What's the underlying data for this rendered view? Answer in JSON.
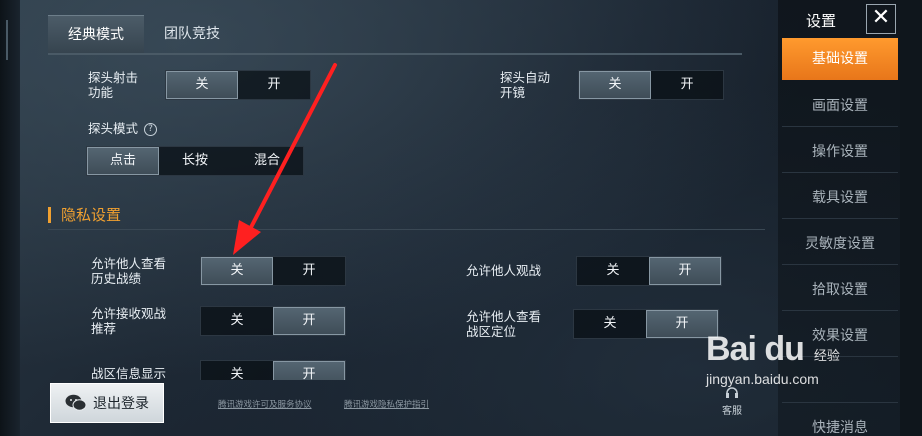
{
  "tabs": [
    {
      "label": "经典模式",
      "active": true
    },
    {
      "label": "团队竞技",
      "active": false
    }
  ],
  "settings": {
    "peek_shoot": {
      "label": "探头射击\n功能",
      "options": [
        "关",
        "开"
      ],
      "selected": "关"
    },
    "peek_auto_scope": {
      "label": "探头自动\n开镜",
      "options": [
        "关",
        "开"
      ],
      "selected": "关"
    },
    "peek_mode": {
      "label": "探头模式",
      "options": [
        "点击",
        "长按",
        "混合"
      ],
      "selected": "点击"
    }
  },
  "privacy": {
    "title": "隐私设置",
    "history": {
      "label": "允许他人查看\n历史战绩",
      "options": [
        "关",
        "开"
      ],
      "selected": "关"
    },
    "spectate": {
      "label": "允许他人观战",
      "options": [
        "关",
        "开"
      ],
      "selected": "开"
    },
    "spectate_push": {
      "label": "允许接收观战\n推荐",
      "options": [
        "关",
        "开"
      ],
      "selected": "开"
    },
    "region": {
      "label": "允许他人查看\n战区定位",
      "options": [
        "关",
        "开"
      ],
      "selected": "开"
    },
    "region_info": {
      "label": "战区信息显示",
      "options": [
        "关",
        "开"
      ],
      "selected": "开"
    }
  },
  "sidebar": {
    "title": "设置",
    "items": [
      {
        "label": "基础设置",
        "active": true
      },
      {
        "label": "画面设置",
        "active": false
      },
      {
        "label": "操作设置",
        "active": false
      },
      {
        "label": "载具设置",
        "active": false
      },
      {
        "label": "灵敏度设置",
        "active": false
      },
      {
        "label": "拾取设置",
        "active": false
      },
      {
        "label": "效果设置",
        "active": false
      },
      {
        "label": "",
        "active": false
      },
      {
        "label": "快捷消息",
        "active": false
      }
    ]
  },
  "footer": {
    "logout_label": "退出登录",
    "link1": "腾讯游戏许可及服务协议",
    "link2": "腾讯游戏隐私保护指引",
    "service_label": "客服"
  },
  "watermark": {
    "logo": "Bai du",
    "extra": "经验",
    "sub": "jingyan.baidu.com"
  },
  "colors": {
    "accent": "#f0a030",
    "active_tab_orange": "#ff9a2e"
  }
}
